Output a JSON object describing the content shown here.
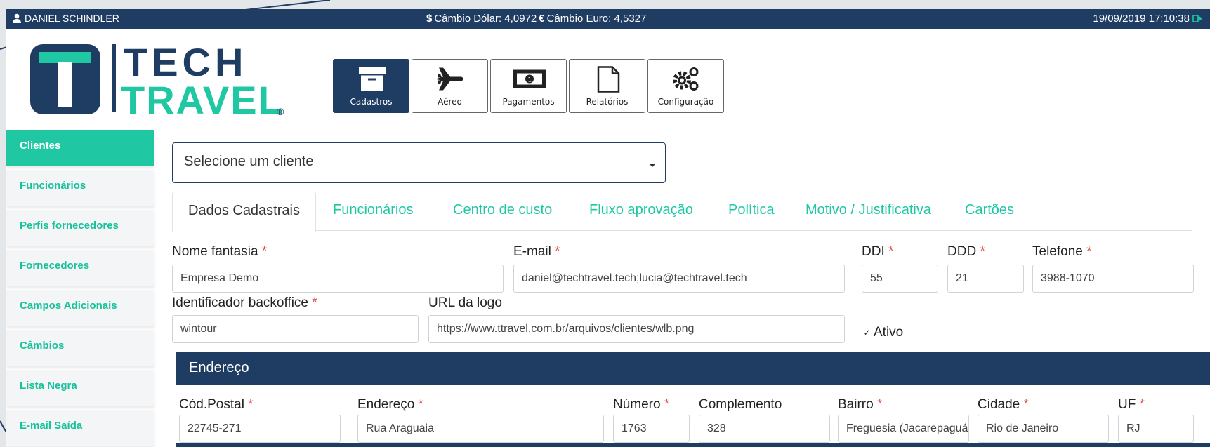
{
  "topbar": {
    "user_name": "DANIEL SCHINDLER",
    "rates_text": "Câmbio Dólar: 4,0972",
    "euro_text": "Câmbio Euro: 4,5327",
    "datetime": "19/09/2019 17:10:38"
  },
  "logo": {
    "line1": "TECH",
    "line2": "TRAVEL",
    "reg": "®"
  },
  "toolbar": [
    {
      "label": "Cadastros",
      "icon": "archive-icon"
    },
    {
      "label": "Aéreo",
      "icon": "plane-icon"
    },
    {
      "label": "Pagamentos",
      "icon": "money-icon"
    },
    {
      "label": "Relatórios",
      "icon": "file-icon"
    },
    {
      "label": "Configuração",
      "icon": "gears-icon"
    }
  ],
  "sidebar": {
    "items": [
      {
        "label": "Clientes"
      },
      {
        "label": "Funcionários"
      },
      {
        "label": "Perfis fornecedores"
      },
      {
        "label": "Fornecedores"
      },
      {
        "label": "Campos Adicionais"
      },
      {
        "label": "Câmbios"
      },
      {
        "label": "Lista Negra"
      },
      {
        "label": "E-mail Saída"
      }
    ]
  },
  "client_select": {
    "placeholder": "Selecione um cliente"
  },
  "tabs": [
    {
      "label": "Dados Cadastrais"
    },
    {
      "label": "Funcionários"
    },
    {
      "label": "Centro de custo"
    },
    {
      "label": "Fluxo aprovação"
    },
    {
      "label": "Política"
    },
    {
      "label": "Motivo / Justificativa"
    },
    {
      "label": "Cartões"
    }
  ],
  "form": {
    "nome_fantasia": {
      "label": "Nome fantasia",
      "value": "Empresa Demo"
    },
    "email": {
      "label": "E-mail",
      "value": "daniel@techtravel.tech;lucia@techtravel.tech"
    },
    "ddi": {
      "label": "DDI",
      "value": "55"
    },
    "ddd": {
      "label": "DDD",
      "value": "21"
    },
    "telefone": {
      "label": "Telefone",
      "value": "3988-1070"
    },
    "backoffice": {
      "label": "Identificador backoffice",
      "value": "wintour"
    },
    "url_logo": {
      "label": "URL da logo",
      "value": "https://www.ttravel.com.br/arquivos/clientes/wlb.png"
    },
    "ativo": {
      "label": "Ativo",
      "checked": true
    },
    "required_mark": "*"
  },
  "endereco": {
    "title": "Endereço",
    "cod_postal": {
      "label": "Cód.Postal",
      "value": "22745-271"
    },
    "endereco": {
      "label": "Endereço",
      "value": "Rua Araguaia"
    },
    "numero": {
      "label": "Número",
      "value": "1763"
    },
    "complemento": {
      "label": "Complemento",
      "value": "328"
    },
    "bairro": {
      "label": "Bairro",
      "value": "Freguesia (Jacarepaguá)"
    },
    "cidade": {
      "label": "Cidade",
      "value": "Rio de Janeiro"
    },
    "uf": {
      "label": "UF",
      "value": "RJ"
    }
  },
  "colors": {
    "navy": "#1f3c63",
    "teal": "#1fc8a3",
    "required": "#d9534f"
  }
}
